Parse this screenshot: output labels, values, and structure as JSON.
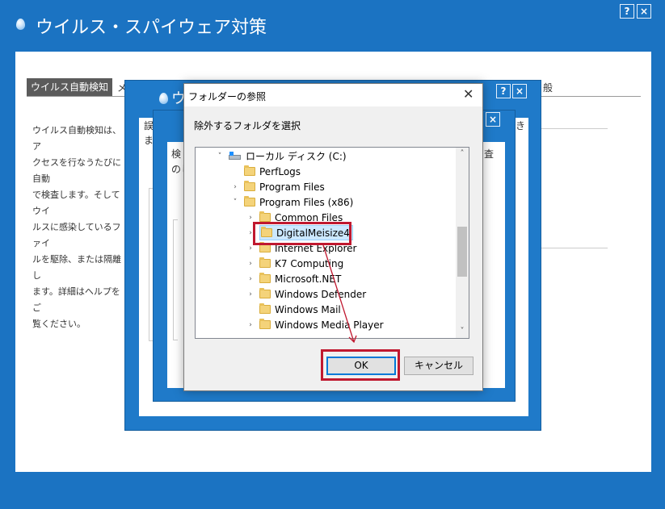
{
  "app": {
    "title": "ウイルス・スパイウェア対策",
    "help_label": "?",
    "close_label": "×"
  },
  "main_panel": {
    "tab_active": "ウイルス自動検知",
    "tab_fragment": "メ",
    "tab_right_fragment": "般",
    "description": "ウイルス自動検知は、ア\nクセスを行なうたびに自動\nで検査します。そしてウイ\nルスに感染しているファイ\nルを駆除、または隔離し\nます。詳細はヘルプをご\n覧ください。"
  },
  "dialog1": {
    "title_fragment": "ウ",
    "text_line1": "誤",
    "text_line2": "ます",
    "text_right": "き",
    "help_label": "?",
    "close_label": "×"
  },
  "dialog2": {
    "text_line1": "検",
    "text_line2": "のし",
    "text_right": "査",
    "close_label": "×"
  },
  "folder_dialog": {
    "title": "フォルダーの参照",
    "close_label": "✕",
    "prompt": "除外するフォルダを選択",
    "tree": [
      {
        "label": "ローカル ディスク (C:)",
        "chevron": "˅",
        "icon": "drive-icon"
      },
      {
        "label": "PerfLogs",
        "chevron": "",
        "icon": "folder-icon"
      },
      {
        "label": "Program Files",
        "chevron": "›",
        "icon": "folder-icon"
      },
      {
        "label": "Program Files (x86)",
        "chevron": "˅",
        "icon": "folder-icon"
      },
      {
        "label": "Common Files",
        "chevron": "›",
        "icon": "folder-icon"
      },
      {
        "label": "DigitalMeisize4",
        "chevron": "›",
        "icon": "folder-icon",
        "selected": true
      },
      {
        "label": "Internet Explorer",
        "chevron": "›",
        "icon": "folder-icon"
      },
      {
        "label": "K7 Computing",
        "chevron": "›",
        "icon": "folder-icon"
      },
      {
        "label": "Microsoft.NET",
        "chevron": "›",
        "icon": "folder-icon"
      },
      {
        "label": "Windows Defender",
        "chevron": "›",
        "icon": "folder-icon"
      },
      {
        "label": "Windows Mail",
        "chevron": "",
        "icon": "folder-icon"
      },
      {
        "label": "Windows Media Player",
        "chevron": "›",
        "icon": "folder-icon"
      }
    ],
    "scroll_up": "˄",
    "scroll_down": "˅",
    "ok_label": "OK",
    "cancel_label": "キャンセル"
  },
  "colors": {
    "background_blue": "#1b73c2",
    "annotation_red": "#c0182f",
    "selection": "#cce8ff",
    "ok_focus": "#0078d7"
  }
}
